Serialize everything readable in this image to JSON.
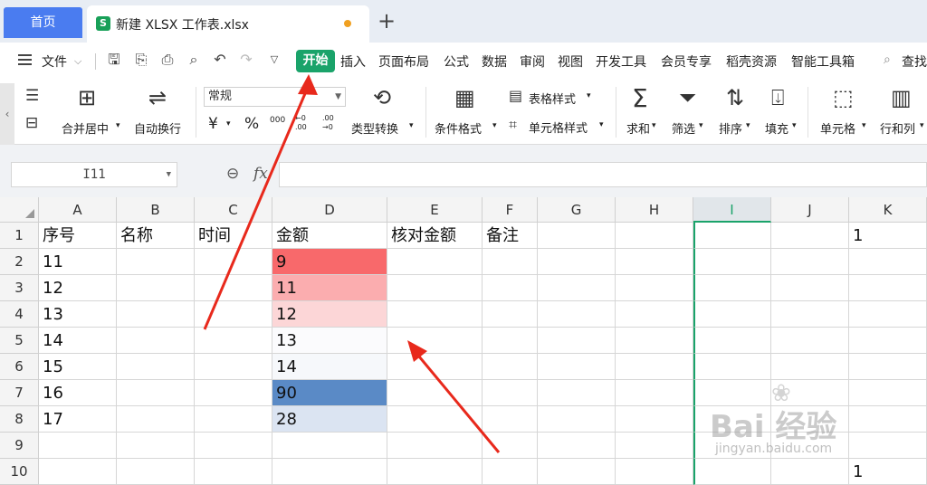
{
  "tabs": {
    "home": "首页",
    "file": "新建 XLSX 工作表.xlsx",
    "file_badge": "S",
    "new_tab": "+"
  },
  "menubar": {
    "file_menu": "文件",
    "tabs": [
      "开始",
      "插入",
      "页面布局",
      "公式",
      "数据",
      "审阅",
      "视图",
      "开发工具",
      "会员专享",
      "稻壳资源",
      "智能工具箱"
    ],
    "search": "查找"
  },
  "ribbon": {
    "number_format": "常规",
    "merge_center": "合并居中",
    "auto_wrap": "自动换行",
    "type_convert": "类型转换",
    "cond_format": "条件格式",
    "table_style": "表格样式",
    "cell_style": "单元格样式",
    "sum": "求和",
    "filter": "筛选",
    "sort": "排序",
    "fill": "填充",
    "cell": "单元格",
    "row_col": "行和列",
    "currency_symbol": "¥",
    "percent_symbol": "%",
    "thousands": "000",
    "dec_inc": "←0 .00",
    "dec_dec": ".00 →0"
  },
  "formula_bar": {
    "name_box": "I11",
    "fx": "fx",
    "value": ""
  },
  "sheet": {
    "columns": [
      "A",
      "B",
      "C",
      "D",
      "E",
      "F",
      "G",
      "H",
      "I",
      "J",
      "K"
    ],
    "rows": [
      "1",
      "2",
      "3",
      "4",
      "5",
      "6",
      "7",
      "8",
      "9",
      "10"
    ],
    "selected_column": "I",
    "header_row": [
      "序号",
      "名称",
      "时间",
      "金额",
      "核对金额",
      "备注",
      "",
      "",
      "",
      "",
      "1"
    ],
    "data": [
      [
        "11",
        "",
        "",
        "9",
        "",
        "",
        "",
        "",
        "",
        "",
        ""
      ],
      [
        "12",
        "",
        "",
        "11",
        "",
        "",
        "",
        "",
        "",
        "",
        ""
      ],
      [
        "13",
        "",
        "",
        "12",
        "",
        "",
        "",
        "",
        "",
        "",
        ""
      ],
      [
        "14",
        "",
        "",
        "13",
        "",
        "",
        "",
        "",
        "",
        "",
        ""
      ],
      [
        "15",
        "",
        "",
        "14",
        "",
        "",
        "",
        "",
        "",
        "",
        ""
      ],
      [
        "16",
        "",
        "",
        "90",
        "",
        "",
        "",
        "",
        "",
        "",
        ""
      ],
      [
        "17",
        "",
        "",
        "28",
        "",
        "",
        "",
        "",
        "",
        "",
        ""
      ],
      [
        "",
        "",
        "",
        "",
        "",
        "",
        "",
        "",
        "",
        "",
        ""
      ],
      [
        "",
        "",
        "",
        "",
        "",
        "",
        "",
        "",
        "",
        "",
        "1"
      ]
    ],
    "d_fill_colors": [
      "#f8696b",
      "#fbadaf",
      "#fcd6d7",
      "#fbfbfd",
      "#f6f8fb",
      "#5a8ac6",
      "#dbe4f2"
    ]
  },
  "colors": {
    "accent_green": "#1aa36a",
    "tab_blue": "#4a7cf0",
    "arrow_red": "#e8291c"
  },
  "watermark": {
    "main": "Bai  经验",
    "sub": "jingyan.baidu.com"
  }
}
